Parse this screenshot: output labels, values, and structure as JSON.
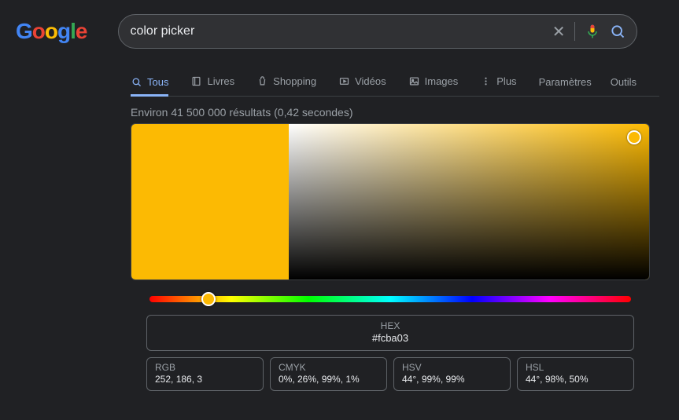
{
  "logo": {
    "g1": "G",
    "o1": "o",
    "o2": "o",
    "g2": "g",
    "l": "l",
    "e": "e"
  },
  "search": {
    "query": "color picker"
  },
  "tabs": {
    "all": "Tous",
    "books": "Livres",
    "shopping": "Shopping",
    "videos": "Vidéos",
    "images": "Images",
    "more": "Plus"
  },
  "tools": {
    "settings": "Paramètres",
    "tools": "Outils"
  },
  "stats": "Environ 41 500 000 résultats (0,42 secondes)",
  "picker": {
    "hex_label": "HEX",
    "hex_value": "#fcba03",
    "rgb_label": "RGB",
    "rgb_value": "252, 186, 3",
    "cmyk_label": "CMYK",
    "cmyk_value": "0%, 26%, 99%, 1%",
    "hsv_label": "HSV",
    "hsv_value": "44°, 99%, 99%",
    "hsl_label": "HSL",
    "hsl_value": "44°, 98%, 50%",
    "selected_color": "#fcba03"
  }
}
